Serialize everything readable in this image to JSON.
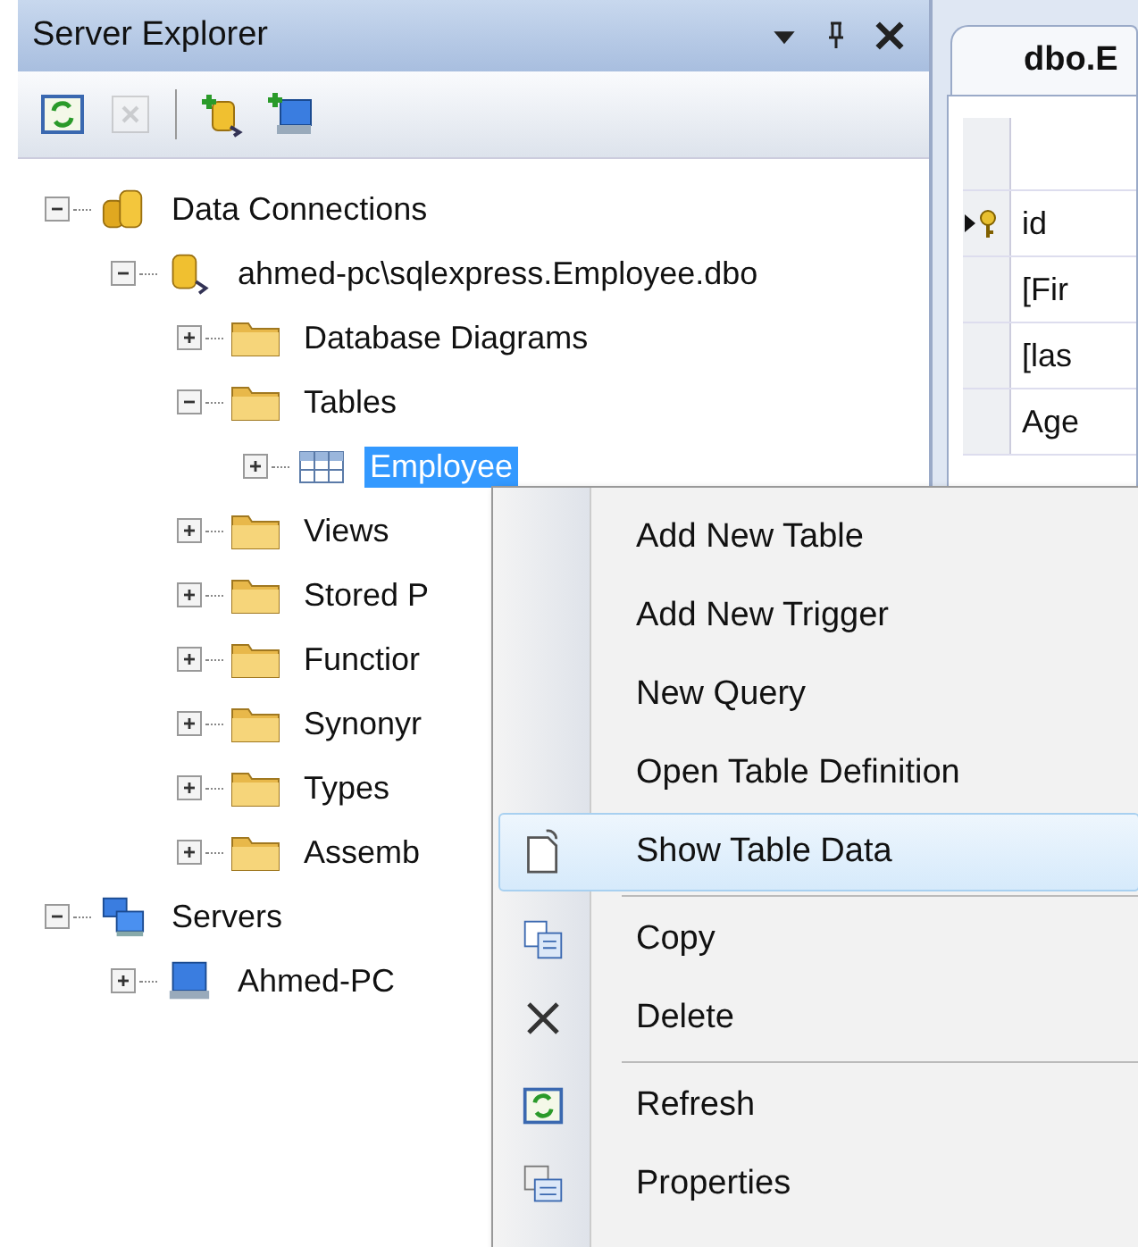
{
  "panel": {
    "title": "Server Explorer",
    "toolbar": [
      {
        "disabled": false
      },
      {
        "disabled": true
      },
      {
        "disabled": false
      },
      {
        "disabled": false
      }
    ]
  },
  "tree": [
    {
      "label": "Data Connections",
      "kind": "database",
      "expanded": true,
      "selected": false,
      "children": [
        {
          "label": "ahmed-pc\\sqlexpress.Employee.dbo",
          "kind": "connection",
          "expanded": true,
          "selected": false,
          "children": [
            {
              "label": "Database Diagrams",
              "kind": "folder",
              "expanded": false,
              "selected": false
            },
            {
              "label": "Tables",
              "kind": "folder",
              "expanded": true,
              "selected": false,
              "children": [
                {
                  "label": "Employee",
                  "kind": "table",
                  "expanded": false,
                  "selected": true
                }
              ]
            },
            {
              "label": "Views",
              "kind": "folder",
              "expanded": false,
              "selected": false
            },
            {
              "label": "Stored P",
              "kind": "folder",
              "expanded": false,
              "selected": false
            },
            {
              "label": "Functior",
              "kind": "folder",
              "expanded": false,
              "selected": false
            },
            {
              "label": "Synonyr",
              "kind": "folder",
              "expanded": false,
              "selected": false
            },
            {
              "label": "Types",
              "kind": "folder",
              "expanded": false,
              "selected": false
            },
            {
              "label": "Assemb",
              "kind": "folder",
              "expanded": false,
              "selected": false
            }
          ]
        }
      ]
    },
    {
      "label": "Servers",
      "kind": "servers",
      "expanded": true,
      "selected": false,
      "children": [
        {
          "label": "Ahmed-PC",
          "kind": "server",
          "expanded": false,
          "selected": false
        }
      ]
    }
  ],
  "document": {
    "tab": "dbo.E",
    "rows": [
      {
        "key": true,
        "cell": "id"
      },
      {
        "key": false,
        "cell": "[Fir"
      },
      {
        "key": false,
        "cell": "[las"
      },
      {
        "key": false,
        "cell": "Age"
      }
    ]
  },
  "menu": {
    "items": [
      {
        "kind": "item",
        "label": "Add New Table",
        "selected": false
      },
      {
        "kind": "item",
        "label": "Add New Trigger",
        "selected": false
      },
      {
        "kind": "item",
        "label": "New Query",
        "selected": false
      },
      {
        "kind": "item",
        "label": "Open Table Definition",
        "selected": false
      },
      {
        "kind": "item",
        "label": "Show Table Data",
        "selected": true
      },
      {
        "kind": "separator"
      },
      {
        "kind": "item",
        "label": "Copy",
        "selected": false
      },
      {
        "kind": "item",
        "label": "Delete",
        "selected": false
      },
      {
        "kind": "separator"
      },
      {
        "kind": "item",
        "label": "Refresh",
        "selected": false
      },
      {
        "kind": "item",
        "label": "Properties",
        "selected": false
      }
    ]
  }
}
